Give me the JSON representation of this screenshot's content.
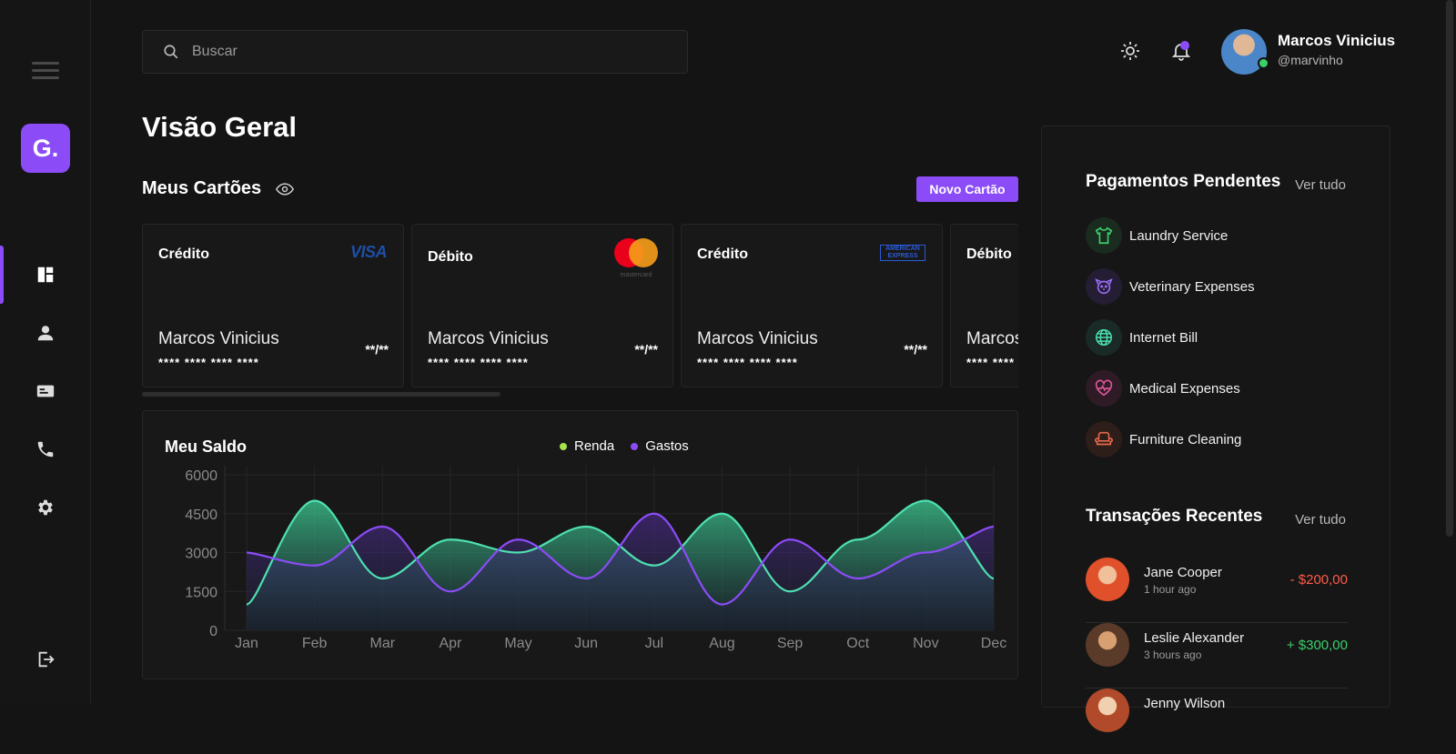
{
  "search": {
    "placeholder": "Buscar"
  },
  "user": {
    "name": "Marcos Vinicius",
    "handle": "@marvinho"
  },
  "logo": {
    "text": "G."
  },
  "page": {
    "title": "Visão Geral"
  },
  "cards_section": {
    "title": "Meus Cartões",
    "new_card_label": "Novo Cartão",
    "cards": [
      {
        "type": "Crédito",
        "brand": "VISA",
        "holder": "Marcos Vinicius",
        "number": "**** **** **** ****",
        "exp": "**/**"
      },
      {
        "type": "Débito",
        "brand": "mastercard",
        "holder": "Marcos Vinicius",
        "number": "**** **** **** ****",
        "exp": "**/**"
      },
      {
        "type": "Crédito",
        "brand": "AMERICAN EXPRESS",
        "holder": "Marcos Vinicius",
        "number": "**** **** **** ****",
        "exp": "**/**"
      },
      {
        "type": "Débito",
        "brand": "",
        "holder": "Marcos Vinicius",
        "number": "**** **** **** ****",
        "exp": "**/**"
      }
    ]
  },
  "balance": {
    "title": "Meu Saldo",
    "legend_income": "Renda",
    "legend_expense": "Gastos"
  },
  "chart_data": {
    "type": "area",
    "categories": [
      "Jan",
      "Feb",
      "Mar",
      "Apr",
      "May",
      "Jun",
      "Jul",
      "Aug",
      "Sep",
      "Oct",
      "Nov",
      "Dec"
    ],
    "series": [
      {
        "name": "Renda",
        "color": "#4ee0b0",
        "values": [
          1000,
          5000,
          2000,
          3500,
          3000,
          4000,
          2500,
          4500,
          1500,
          3500,
          5000,
          2000
        ]
      },
      {
        "name": "Gastos",
        "color": "#8b4cf7",
        "values": [
          3000,
          2500,
          4000,
          1500,
          3500,
          2000,
          4500,
          1000,
          3500,
          2000,
          3000,
          4000
        ]
      }
    ],
    "yticks": [
      0,
      1500,
      3000,
      4500,
      6000
    ],
    "ylim": [
      0,
      6000
    ],
    "grid": true,
    "legend_position": "top-center"
  },
  "pending": {
    "title": "Pagamentos Pendentes",
    "see_all": "Ver tudo",
    "items": [
      {
        "label": "Laundry Service",
        "icon": "shirt-icon",
        "color": "#3ad06a"
      },
      {
        "label": "Veterinary Expenses",
        "icon": "pet-icon",
        "color": "#9b6cf7"
      },
      {
        "label": "Internet Bill",
        "icon": "globe-icon",
        "color": "#4ee0b0"
      },
      {
        "label": "Medical Expenses",
        "icon": "heart-pulse-icon",
        "color": "#e0569a"
      },
      {
        "label": "Furniture Cleaning",
        "icon": "sofa-icon",
        "color": "#e8694a"
      }
    ]
  },
  "transactions": {
    "title": "Transações Recentes",
    "see_all": "Ver tudo",
    "items": [
      {
        "name": "Jane Cooper",
        "time": "1 hour ago",
        "amount": "- $200,00",
        "color": "#ff5a4a"
      },
      {
        "name": "Leslie Alexander",
        "time": "3 hours ago",
        "amount": "+ $300,00",
        "color": "#3ad06a"
      },
      {
        "name": "Jenny Wilson",
        "time": "",
        "amount": "",
        "color": "#3ad06a"
      }
    ]
  }
}
